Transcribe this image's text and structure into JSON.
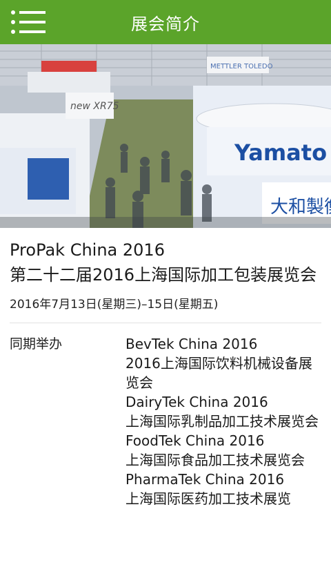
{
  "header": {
    "title": "展会简介"
  },
  "event": {
    "title_en": "ProPak China 2016",
    "title_cn": "第二十二届2016上海国际加工包装展览会",
    "date": "2016年7月13日(星期三)–15日(星期五)"
  },
  "concurrent": {
    "label": "同期举办",
    "items": [
      {
        "en": "BevTek China 2016",
        "cn": "2016上海国际饮料机械设备展览会"
      },
      {
        "en": "DairyTek China 2016",
        "cn": "上海国际乳制品加工技术展览会"
      },
      {
        "en": "FoodTek China 2016",
        "cn": "上海国际食品加工技术展览会"
      },
      {
        "en": "PharmaTek China 2016",
        "cn": "上海国际医药加工技术展览"
      }
    ]
  },
  "hero": {
    "signs": [
      "new XR75",
      "METTLER TOLEDO",
      "Yamato",
      "大和製衡"
    ]
  },
  "colors": {
    "accent": "#5ba42a",
    "yamato_blue": "#1c4fa3"
  }
}
